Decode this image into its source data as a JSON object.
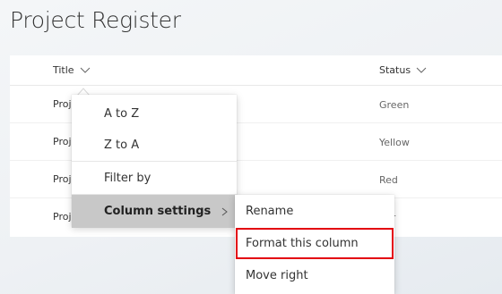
{
  "page": {
    "title": "Project Register"
  },
  "columns": {
    "title": "Title",
    "status": "Status"
  },
  "rows": [
    {
      "title": "Proj",
      "status": "Green"
    },
    {
      "title": "Proj",
      "status": "Yellow"
    },
    {
      "title": "Proj",
      "status": "Red"
    },
    {
      "title": "Proj",
      "status": "ber"
    }
  ],
  "menu": {
    "items": [
      "A to Z",
      "Z to A",
      "Filter by",
      "Column settings"
    ]
  },
  "submenu": {
    "items": [
      "Rename",
      "Format this column",
      "Move right"
    ]
  },
  "colors": {
    "highlight": "#e3000f",
    "active_menu_bg": "#c8c8c8"
  }
}
